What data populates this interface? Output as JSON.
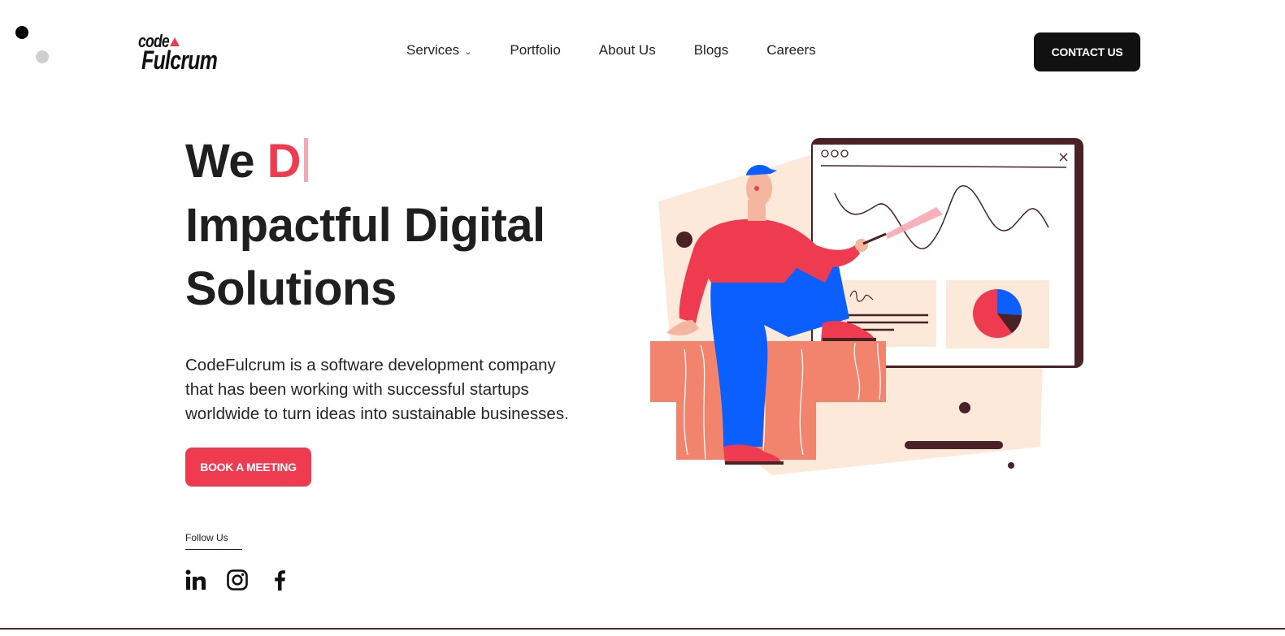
{
  "logo": {
    "line1": "code",
    "line2": "Fulcrum",
    "accent_color": "#ef3b4f"
  },
  "nav": {
    "items": [
      {
        "label": "Services"
      },
      {
        "label": "Portfolio"
      },
      {
        "label": "About Us"
      },
      {
        "label": "Blogs"
      },
      {
        "label": "Careers"
      }
    ],
    "services_chevron": "⌄"
  },
  "contact_button": {
    "label": "CONTACT US"
  },
  "hero": {
    "prefix": "We ",
    "typed": "D",
    "line2": "Impactful Digital",
    "line3": "Solutions",
    "accent_color": "#ef3b4f"
  },
  "description": {
    "lines": [
      "CodeFulcrum is a software development company",
      "that has been working with successful startups",
      "worldwide to turn ideas into sustainable businesses."
    ]
  },
  "book_button": {
    "label": "BOOK A MEETING"
  },
  "follow": {
    "label": "Follow Us"
  },
  "social": [
    {
      "icon": "linkedin-icon"
    },
    {
      "icon": "instagram-icon"
    },
    {
      "icon": "facebook-icon"
    }
  ],
  "colors": {
    "primary_red": "#ef3b4f",
    "dark": "#111111",
    "blue": "#0b5fff",
    "peach": "#fde9da",
    "salmon": "#f2836c",
    "brown": "#4a2226"
  }
}
